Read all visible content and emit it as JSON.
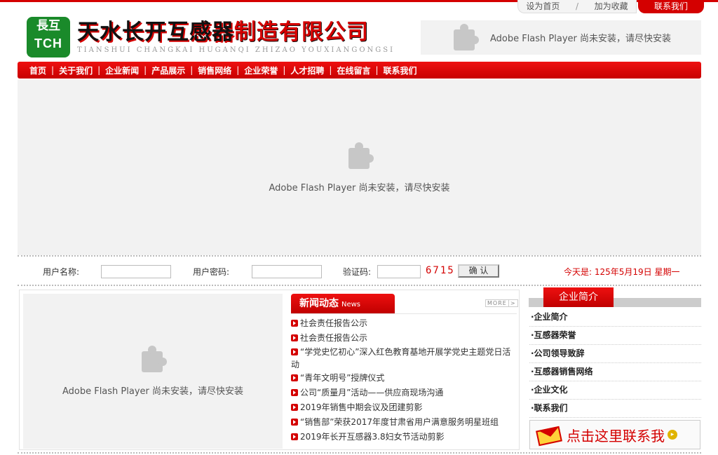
{
  "toplinks": {
    "home": "设为首页",
    "sep": "/",
    "fav": "加为收藏",
    "contact": "联系我们"
  },
  "logo": {
    "badge_top": "長互",
    "badge_bottom": "TCH",
    "name_part1": "天水长开互感器",
    "name_part2": "制造有限公司",
    "subtitle": "TIANSHUI CHANGKAI HUGANQI ZHIZAO YOUXIANGONGSI"
  },
  "flash": {
    "message": "Adobe Flash Player 尚未安装，请尽快安装"
  },
  "nav": {
    "items": [
      "首页",
      "关于我们",
      "企业新闻",
      "产品展示",
      "销售网络",
      "企业荣誉",
      "人才招聘",
      "在线留言",
      "联系我们"
    ],
    "sep": "|"
  },
  "login": {
    "username_label": "用户名称:",
    "password_label": "用户密码:",
    "captcha_label": "验证码:",
    "captcha_code": "6715",
    "submit_label": "确 认",
    "today": "今天是: 125年5月19日 星期一"
  },
  "news": {
    "title": "新闻动态",
    "title_en": "News",
    "more": "MORE",
    "items": [
      "社会责任报告公示",
      "社会责任报告公示",
      "“学党史忆初心”深入红色教育基地开展学党史主题党日活动",
      "“青年文明号”授牌仪式",
      "公司“质量月”活动——供应商现场沟通",
      "2019年销售中期会议及团建剪影",
      "“销售部”荣获2017年度甘肃省用户满意服务明星班组",
      "2019年长开互感器3.8妇女节活动剪影"
    ]
  },
  "sidebar": {
    "title": "企业简介",
    "items": [
      "·企业简介",
      "·互感器荣誉",
      "·公司领导致辞",
      "·互感器销售网络",
      "·企业文化",
      "·联系我们"
    ],
    "banner": "点击这里联系我"
  }
}
